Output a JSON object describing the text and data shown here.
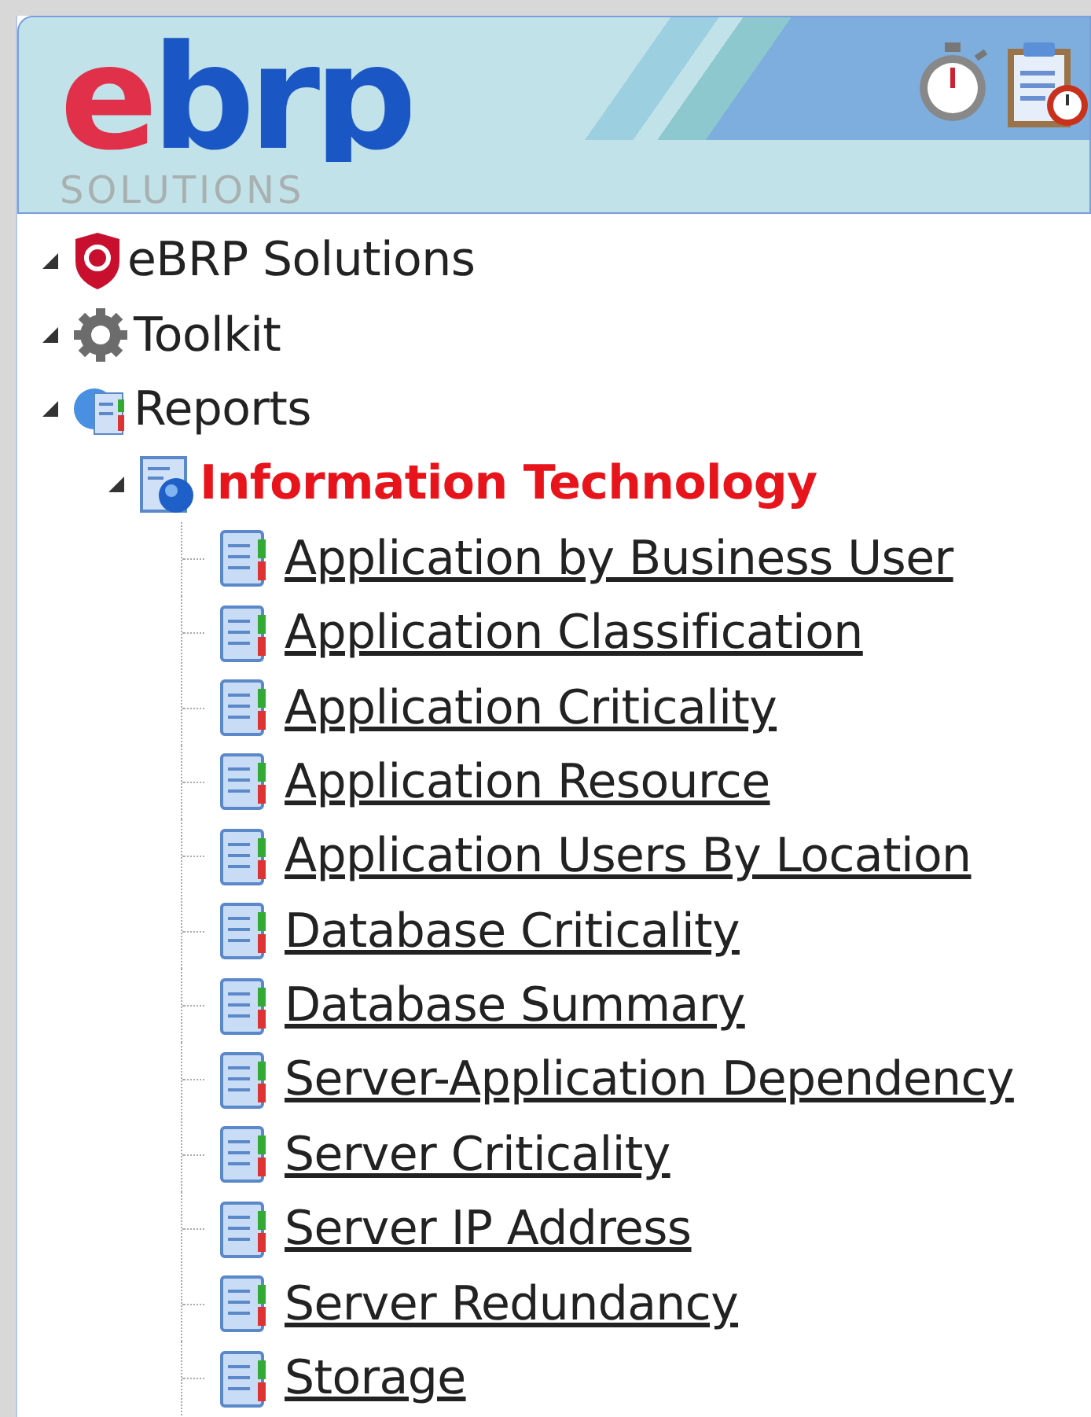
{
  "header": {
    "logo": {
      "wordmark": "ebrp",
      "tagline": "SOLUTIONS"
    },
    "tools": [
      {
        "kind": "stopwatch"
      },
      {
        "kind": "clipboard"
      }
    ]
  },
  "tree": [
    {
      "label": "eBRP Solutions",
      "kind": "brand",
      "expanded": true,
      "selected": false
    },
    {
      "label": "Toolkit",
      "kind": "toolkit",
      "expanded": true,
      "selected": false
    },
    {
      "label": "Reports",
      "kind": "reports",
      "expanded": true,
      "selected": false,
      "children": [
        {
          "label": "Information Technology",
          "kind": "folder",
          "expanded": true,
          "selected": true,
          "children": [
            {
              "label": "Application by Business User",
              "kind": "report",
              "selected": false
            },
            {
              "label": "Application Classification",
              "kind": "report",
              "selected": false
            },
            {
              "label": "Application Criticality",
              "kind": "report",
              "selected": false
            },
            {
              "label": "Application Resource",
              "kind": "report",
              "selected": false
            },
            {
              "label": "Application Users By Location",
              "kind": "report",
              "selected": false
            },
            {
              "label": "Database Criticality",
              "kind": "report",
              "selected": false
            },
            {
              "label": "Database Summary",
              "kind": "report",
              "selected": false
            },
            {
              "label": "Server-Application Dependency",
              "kind": "report",
              "selected": false
            },
            {
              "label": "Server Criticality",
              "kind": "report",
              "selected": false
            },
            {
              "label": "Server IP Address",
              "kind": "report",
              "selected": false
            },
            {
              "label": "Server Redundancy",
              "kind": "report",
              "selected": false
            },
            {
              "label": "Storage",
              "kind": "report",
              "selected": false
            }
          ]
        }
      ]
    }
  ]
}
